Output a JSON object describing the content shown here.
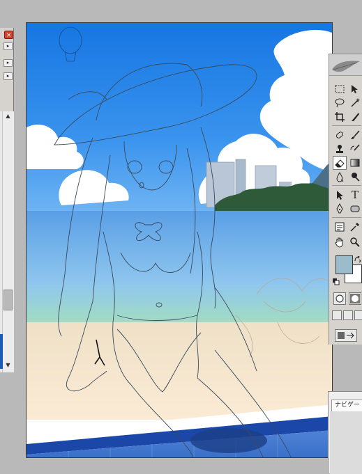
{
  "left_panel": {
    "close_glyph": "×",
    "buttons": [
      "▸",
      "▸",
      "▸"
    ],
    "scroll_up": "▲",
    "scroll_down": "▼"
  },
  "canvas": {
    "description_text": ""
  },
  "tools": {
    "items": [
      "rect-marquee",
      "move",
      "lasso",
      "magic-wand",
      "crop",
      "slice",
      "healing-brush",
      "brush",
      "clone-stamp",
      "history-brush",
      "eraser",
      "gradient",
      "blur",
      "dodge",
      "path-select",
      "type",
      "pen",
      "shape",
      "notes",
      "eyedropper",
      "hand",
      "zoom"
    ],
    "type_glyph": "T",
    "foreground_color": "#9bbccb",
    "background_color": "#ffffff"
  },
  "navigator": {
    "tab_label": "ナビゲー"
  }
}
